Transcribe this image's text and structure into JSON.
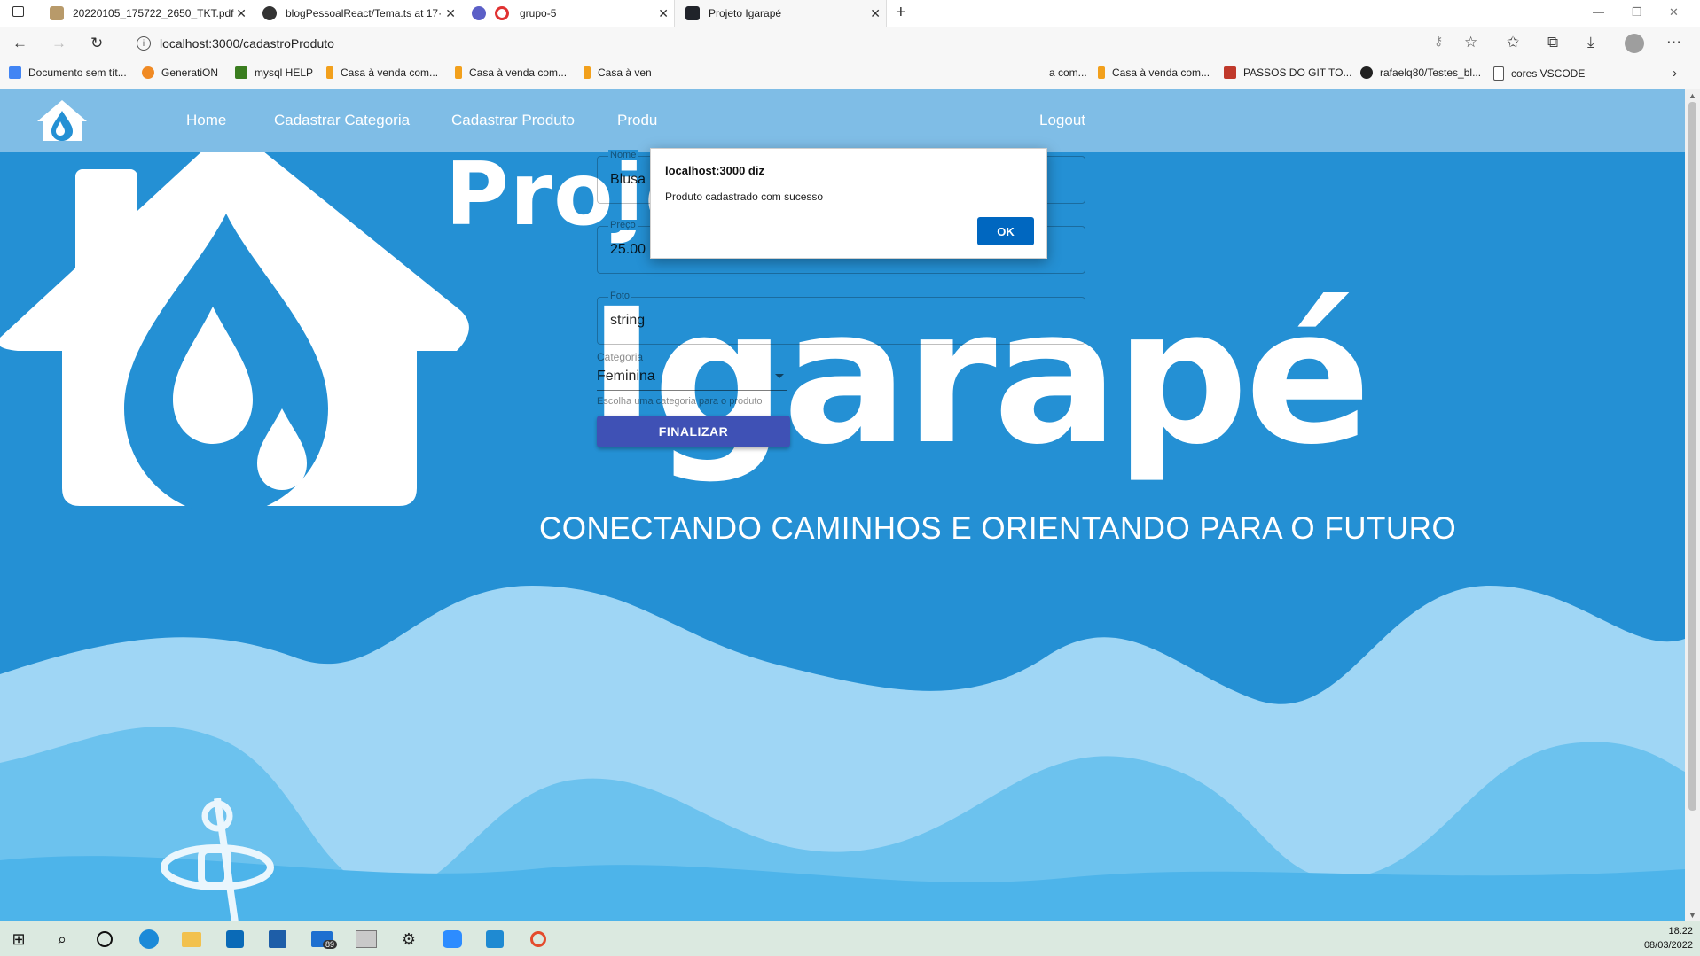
{
  "browser": {
    "tabs": [
      {
        "title": "20220105_175722_2650_TKT.pdf",
        "icon": "pdf-icon"
      },
      {
        "title": "blogPessoalReact/Tema.ts at 17·",
        "icon": "github-icon"
      },
      {
        "title": "grupo-5",
        "icon": "recording-icon"
      },
      {
        "title": "Projeto Igarapé",
        "icon": "react-icon",
        "active": true
      }
    ],
    "new_tab_symbol": "+",
    "url": "localhost:3000/cadastroProduto",
    "bookmarks": [
      "Documento sem tít...",
      "GeneratiON",
      "mysql HELP",
      "Casa à venda com...",
      "Casa à venda com...",
      "Casa à ven",
      "a com...",
      "Casa à venda com...",
      "PASSOS DO GIT TO...",
      "rafaelq80/Testes_bl...",
      "cores VSCODE"
    ]
  },
  "site": {
    "nav_links": [
      "Home",
      "Cadastrar Categoria",
      "Cadastrar Produto",
      "Produ",
      "Logout"
    ],
    "hero_title_line1": "Projeto",
    "hero_title_line2": "Igarapé",
    "tagline": "CONECTANDO CAMINHOS E ORIENTANDO PARA O FUTURO"
  },
  "form": {
    "nome": {
      "label": "Nome",
      "value": "Blusa"
    },
    "preco": {
      "label": "Preço",
      "value": "25.00"
    },
    "foto": {
      "label": "Foto",
      "value": "string"
    },
    "categoria": {
      "label": "Categoria",
      "value": "Feminina",
      "helper": "Escolha uma categoria para o produto"
    },
    "submit_label": "FINALIZAR"
  },
  "dialog": {
    "title": "localhost:3000 diz",
    "message": "Produto cadastrado com sucesso",
    "ok_label": "OK"
  },
  "taskbar": {
    "mail_badge": "89",
    "time": "18:22",
    "date": "08/03/2022"
  },
  "colors": {
    "page_background": "#2490d4",
    "navbar": "#7fbde6",
    "button_primary": "#3f51b5",
    "dialog_ok": "#0067c0"
  }
}
